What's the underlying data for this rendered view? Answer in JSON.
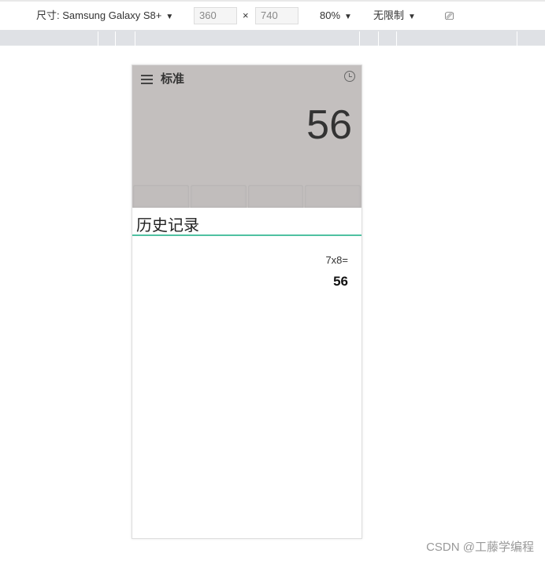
{
  "toolbar": {
    "device_label": "尺寸: Samsung Galaxy S8+",
    "width": "360",
    "x": "×",
    "height": "740",
    "zoom": "80%",
    "throttle": "无限制"
  },
  "calculator": {
    "mode": "标准",
    "display": "56",
    "history_title": "历史记录",
    "history": [
      {
        "expression": "7x8=",
        "result": "56"
      }
    ]
  },
  "watermark": "CSDN @工藤学编程"
}
